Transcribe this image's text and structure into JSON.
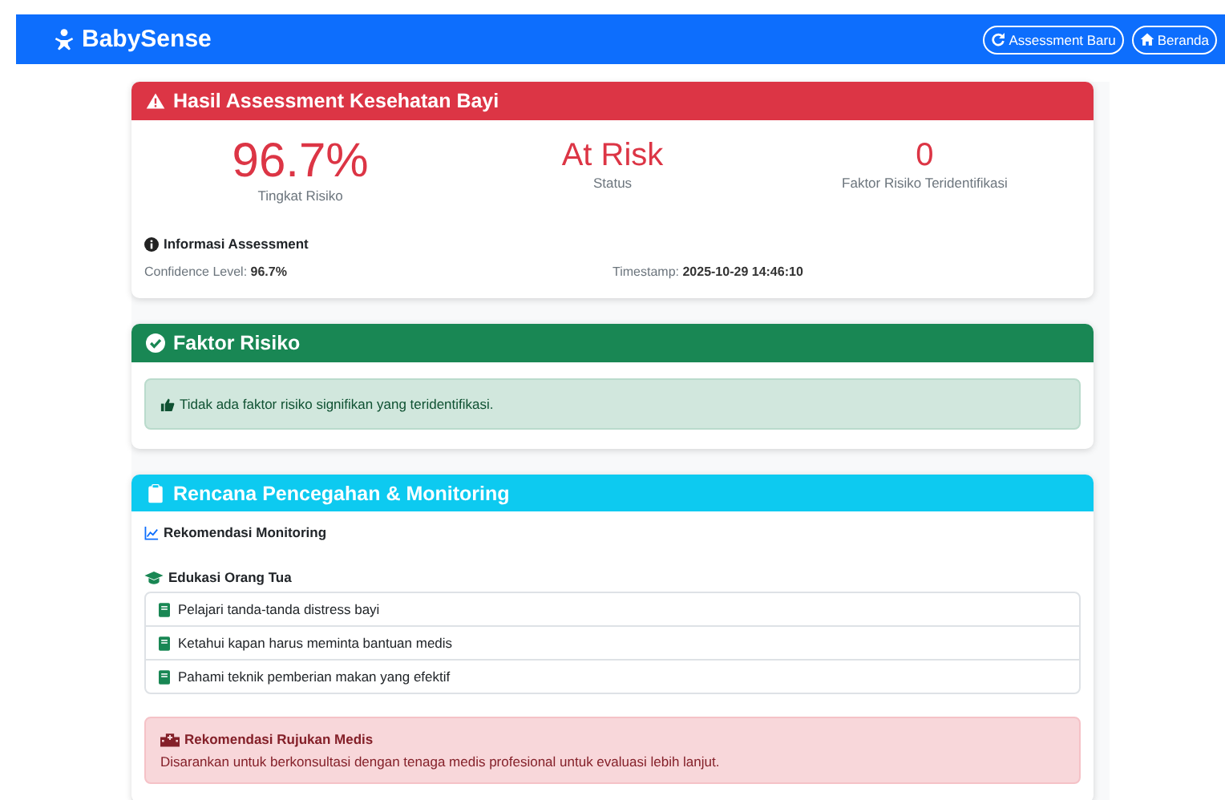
{
  "navbar": {
    "brand": "BabySense",
    "buttons": [
      {
        "label": "Assessment Baru",
        "kind": "redo"
      },
      {
        "label": "Beranda",
        "kind": "home"
      }
    ]
  },
  "result": {
    "title": "Hasil Assessment Kesehatan Bayi",
    "stats": [
      {
        "value": "96.7%",
        "label": "Tingkat Risiko"
      },
      {
        "value": "At Risk",
        "label": "Status"
      },
      {
        "value": "0",
        "label": "Faktor Risiko Teridentifikasi"
      }
    ],
    "info_title": "Informasi Assessment",
    "info": [
      {
        "label": "Confidence Level:",
        "value": "96.7%"
      },
      {
        "label": "Timestamp:",
        "value": "2025-10-29 14:46:10"
      }
    ]
  },
  "factors": {
    "title": "Faktor Risiko",
    "message": "Tidak ada faktor risiko signifikan yang teridentifikasi."
  },
  "plan": {
    "title": "Rencana Pencegahan & Monitoring",
    "monitoring_title": "Rekomendasi Monitoring",
    "education_title": "Edukasi Orang Tua",
    "education": [
      "Pelajari tanda-tanda distress bayi",
      "Ketahui kapan harus meminta bantuan medis",
      "Pahami teknik pemberian makan yang efektif"
    ],
    "referral_title": "Rekomendasi Rujukan Medis",
    "referral_text": "Disarankan untuk berkonsultasi dengan tenaga medis profesional untuk evaluasi lebih lanjut."
  }
}
